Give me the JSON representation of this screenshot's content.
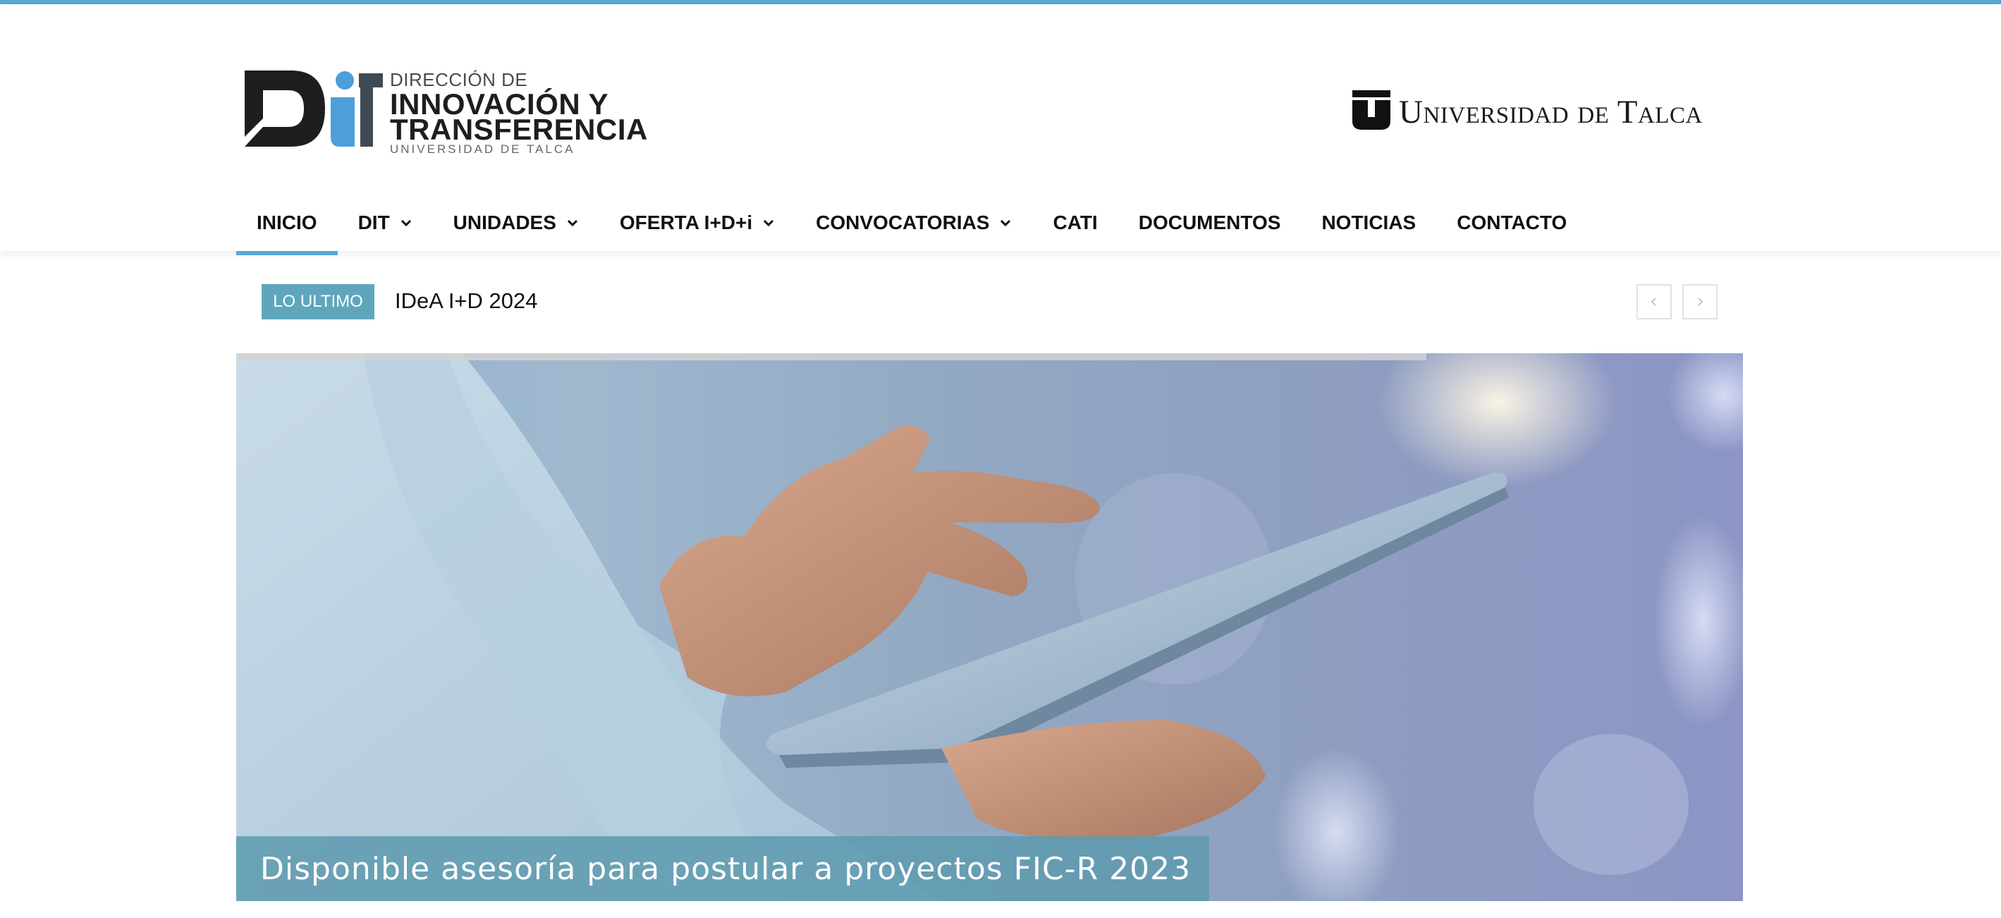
{
  "logo": {
    "line1": "DIRECCIÓN DE",
    "line2": "INNOVACIÓN Y",
    "line3": "TRANSFERENCIA",
    "line4": "UNIVERSIDAD DE TALCA"
  },
  "partner_logo": {
    "text": "Universidad de Talca"
  },
  "nav": {
    "items": [
      {
        "label": "INICIO",
        "active": true,
        "dropdown": false
      },
      {
        "label": "DIT",
        "active": false,
        "dropdown": true
      },
      {
        "label": "UNIDADES",
        "active": false,
        "dropdown": true
      },
      {
        "label": "OFERTA I+D+i",
        "active": false,
        "dropdown": true
      },
      {
        "label": "CONVOCATORIAS",
        "active": false,
        "dropdown": true
      },
      {
        "label": "CATI",
        "active": false,
        "dropdown": false
      },
      {
        "label": "DOCUMENTOS",
        "active": false,
        "dropdown": false
      },
      {
        "label": "NOTICIAS",
        "active": false,
        "dropdown": false
      },
      {
        "label": "CONTACTO",
        "active": false,
        "dropdown": false
      }
    ]
  },
  "ticker": {
    "badge": "LO ULTIMO",
    "headline": "IDeA I+D 2024",
    "prev_icon": "chevron-left-icon",
    "next_icon": "chevron-right-icon"
  },
  "hero": {
    "caption": "Disponible asesoría para postular a proyectos FIC-R 2023",
    "slide_progress": 0.79
  },
  "colors": {
    "accent": "#5aa6d6",
    "badge": "#5fa6bd",
    "caption_bg": "#5f9baf"
  }
}
